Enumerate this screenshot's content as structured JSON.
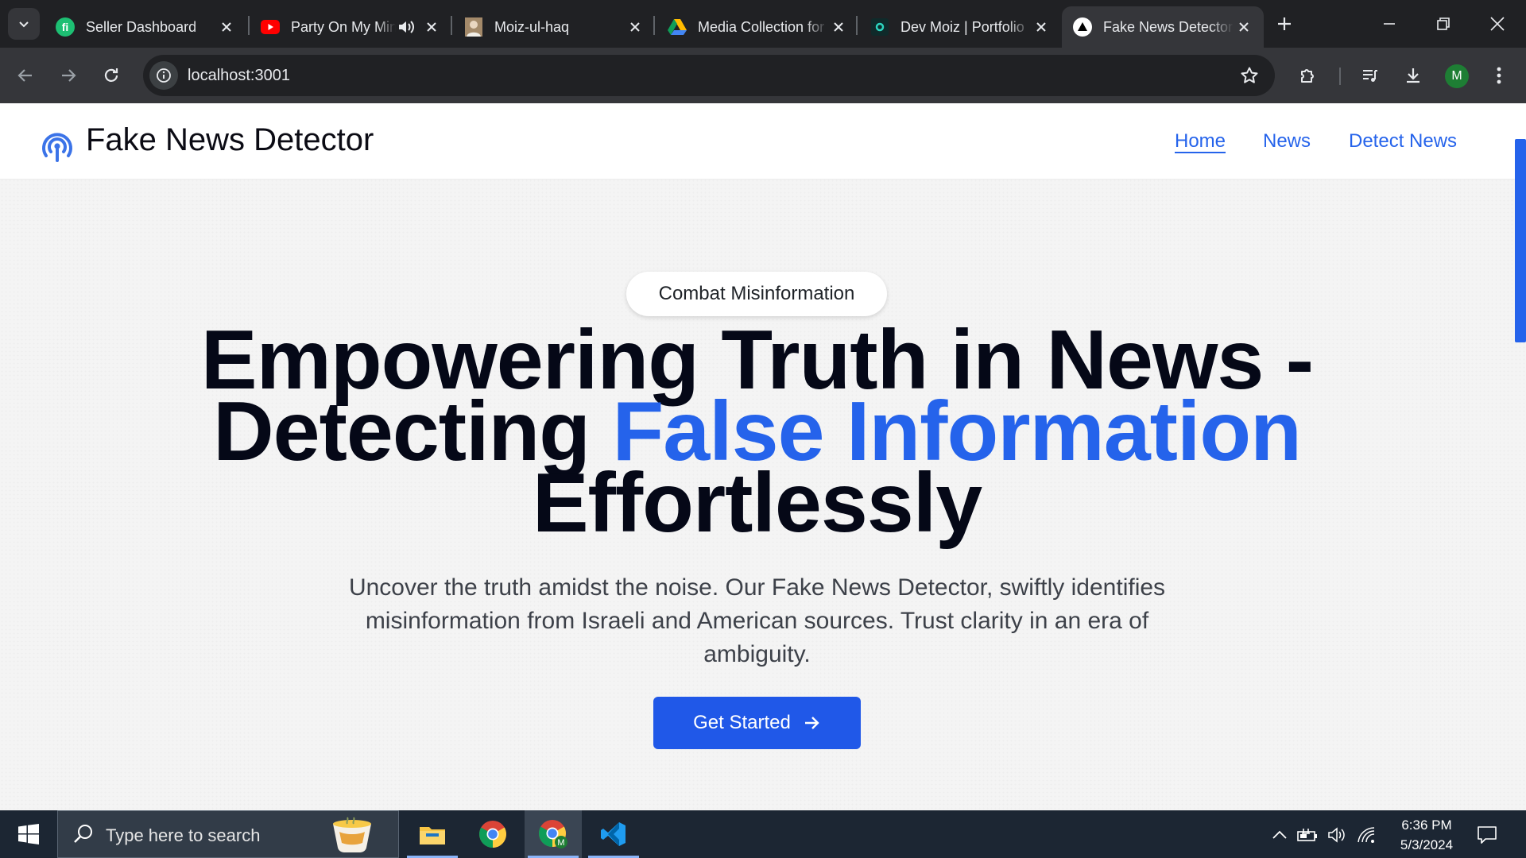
{
  "browser": {
    "tabs": [
      {
        "title": "Seller Dashboard",
        "favicon": "fiverr-icon",
        "active": false
      },
      {
        "title": "Party On My Mind",
        "favicon": "youtube-icon",
        "active": false,
        "audio": true
      },
      {
        "title": "Moiz-ul-haq",
        "favicon": "profile-photo-icon",
        "active": false
      },
      {
        "title": "Media Collection for",
        "favicon": "google-drive-icon",
        "active": false
      },
      {
        "title": "Dev Moiz | Portfolio",
        "favicon": "portfolio-icon",
        "active": false
      },
      {
        "title": "Fake News Detector",
        "favicon": "nextjs-triangle-icon",
        "active": true
      }
    ],
    "url": "localhost:3001",
    "profile_initial": "M"
  },
  "site": {
    "brand_name": "Fake News Detector",
    "nav": [
      {
        "label": "Home",
        "active": true
      },
      {
        "label": "News",
        "active": false
      },
      {
        "label": "Detect News",
        "active": false
      }
    ],
    "hero": {
      "badge": "Combat Misinformation",
      "headline_line1": "Empowering Truth in News -",
      "headline_part2": "Detecting ",
      "headline_accent": "False Information",
      "headline_line3": "Effortlessly",
      "subtitle": "Uncover the truth amidst the noise. Our Fake News Detector, swiftly identifies misinformation from Israeli and American sources. Trust clarity in an era of ambiguity.",
      "cta_label": "Get Started"
    },
    "colors": {
      "accent": "#2563eb",
      "heading": "#050817"
    }
  },
  "taskbar": {
    "search_placeholder": "Type here to search",
    "apps": [
      "file-explorer-icon",
      "chrome-icon",
      "chrome-profile-icon",
      "vscode-icon"
    ],
    "time": "6:36 PM",
    "date": "5/3/2024"
  }
}
